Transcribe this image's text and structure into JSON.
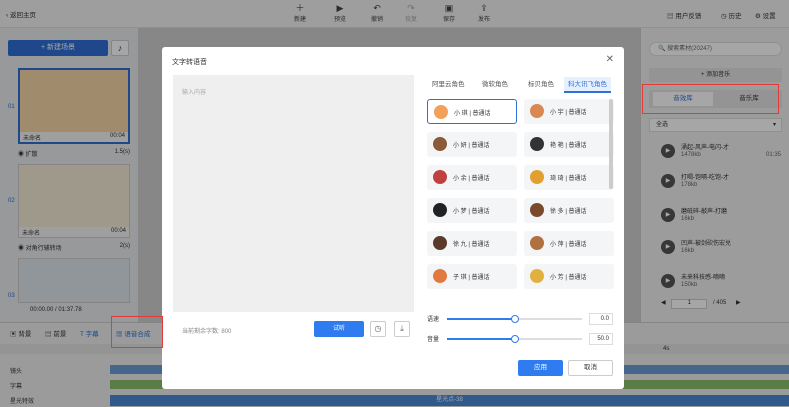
{
  "topbar": {
    "back": "返回主页",
    "actions": [
      {
        "label": "新建",
        "icon": "new-icon"
      },
      {
        "label": "预览",
        "icon": "play-icon"
      },
      {
        "label": "撤销",
        "icon": "undo-icon"
      },
      {
        "label": "恢复",
        "icon": "redo-icon"
      },
      {
        "label": "保存",
        "icon": "save-icon"
      },
      {
        "label": "发布",
        "icon": "publish-icon"
      }
    ],
    "right": {
      "feedback": "用户反馈",
      "history": "历史",
      "settings": "设置"
    }
  },
  "left": {
    "new_scene": "+ 新建场景",
    "scenes": [
      {
        "num": "01",
        "name": "未命名",
        "time": "00:04"
      },
      {
        "num": "02",
        "name": "未命名",
        "time": "00:04"
      },
      {
        "num": "03",
        "name": "",
        "time": ""
      }
    ],
    "transitions": [
      {
        "name": "扩散",
        "duration": "1.5(s)"
      },
      {
        "name": "对角行辅转场",
        "duration": "2(s)"
      }
    ],
    "total_time": "00:00.00 / 01:37.78"
  },
  "right": {
    "search_placeholder": "搜索素材(20247)",
    "add_music": "+ 添加音乐",
    "tabs": [
      "音效库",
      "音乐库"
    ],
    "filter": "全选",
    "items": [
      {
        "title": "涌起-风声-电闪-才",
        "size": "1478kb",
        "duration": "01:35"
      },
      {
        "title": "打喝-饱嗝-吃饱-才",
        "size": "178kb",
        "duration": ""
      },
      {
        "title": "磨砥碎-敲声-打磨",
        "size": "16kb",
        "duration": ""
      },
      {
        "title": "凹声-被剑砍伤宏兑",
        "size": "16kb",
        "duration": ""
      },
      {
        "title": "未来科技感-嘀嘀",
        "size": "150kb",
        "duration": ""
      }
    ],
    "page_current": "1",
    "page_total": "/ 405"
  },
  "timeline": {
    "tools": [
      "背景",
      "前景",
      "字幕",
      "语音合成"
    ],
    "tracks": [
      "镜头",
      "字幕",
      "星光特效"
    ],
    "clip_label": "星光点-38",
    "ruler_mark": "4s"
  },
  "modal": {
    "title": "文字转语音",
    "placeholder": "输入内容",
    "char_count": "当前剩余字数: 800",
    "listen": "试听",
    "tabs": [
      "阿里云角色",
      "微软角色",
      "标贝角色",
      "科大讯飞角色"
    ],
    "voices": [
      {
        "name": "小 琪 | 普通话",
        "color": "#f2a05a"
      },
      {
        "name": "小 宇 | 普通话",
        "color": "#d88850"
      },
      {
        "name": "小 妍 | 普通话",
        "color": "#8a5a3a"
      },
      {
        "name": "艳 艳 | 普通话",
        "color": "#333333"
      },
      {
        "name": "小 余 | 普通话",
        "color": "#c04040"
      },
      {
        "name": "琦 琦 | 普通话",
        "color": "#e2a030"
      },
      {
        "name": "小 梦 | 普通话",
        "color": "#222222"
      },
      {
        "name": "徐 多 | 普通话",
        "color": "#7a4a2a"
      },
      {
        "name": "徐 九 | 普通话",
        "color": "#5a3a2a"
      },
      {
        "name": "小 萍 | 普通话",
        "color": "#b07040"
      },
      {
        "name": "子 琪 | 普通话",
        "color": "#e27a40"
      },
      {
        "name": "小 芳 | 普通话",
        "color": "#e2b040"
      }
    ],
    "speed_label": "语速",
    "speed_value": "0.0",
    "speed_ratio": 0.5,
    "volume_label": "音量",
    "volume_value": "50.0",
    "volume_ratio": 0.5,
    "apply": "应用",
    "cancel": "取消"
  }
}
